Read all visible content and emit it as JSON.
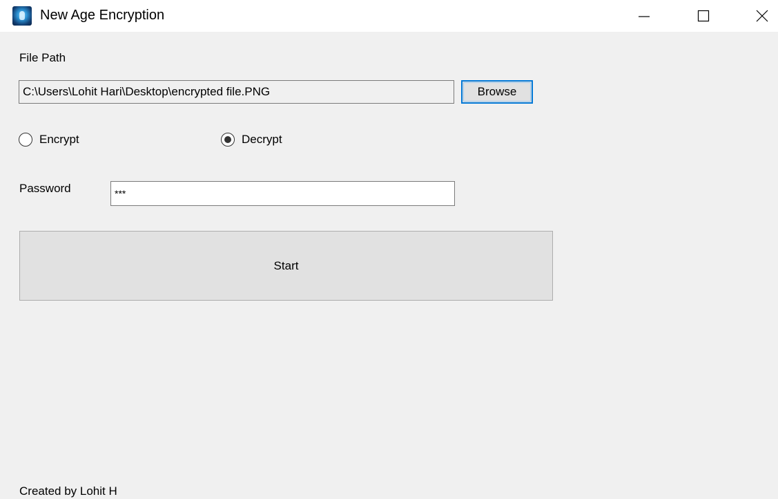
{
  "window": {
    "title": "New Age Encryption",
    "icon": "app-logo-icon",
    "controls": [
      "minimize-icon",
      "maximize-icon",
      "close-icon"
    ]
  },
  "form": {
    "file_path_label": "File Path",
    "file_path_value": "C:\\Users\\Lohit Hari\\Desktop\\encrypted file.PNG",
    "browse_label": "Browse",
    "mode_options": [
      {
        "label": "Encrypt",
        "selected": false
      },
      {
        "label": "Decrypt",
        "selected": true
      }
    ],
    "password_label": "Password",
    "password_value": "***",
    "start_label": "Start"
  },
  "footer": {
    "credit": "Created by Lohit H"
  },
  "colors": {
    "background": "#f0f0f0",
    "titlebar": "#ffffff",
    "focus_border": "#0078d7",
    "button_face": "#e1e1e1"
  }
}
